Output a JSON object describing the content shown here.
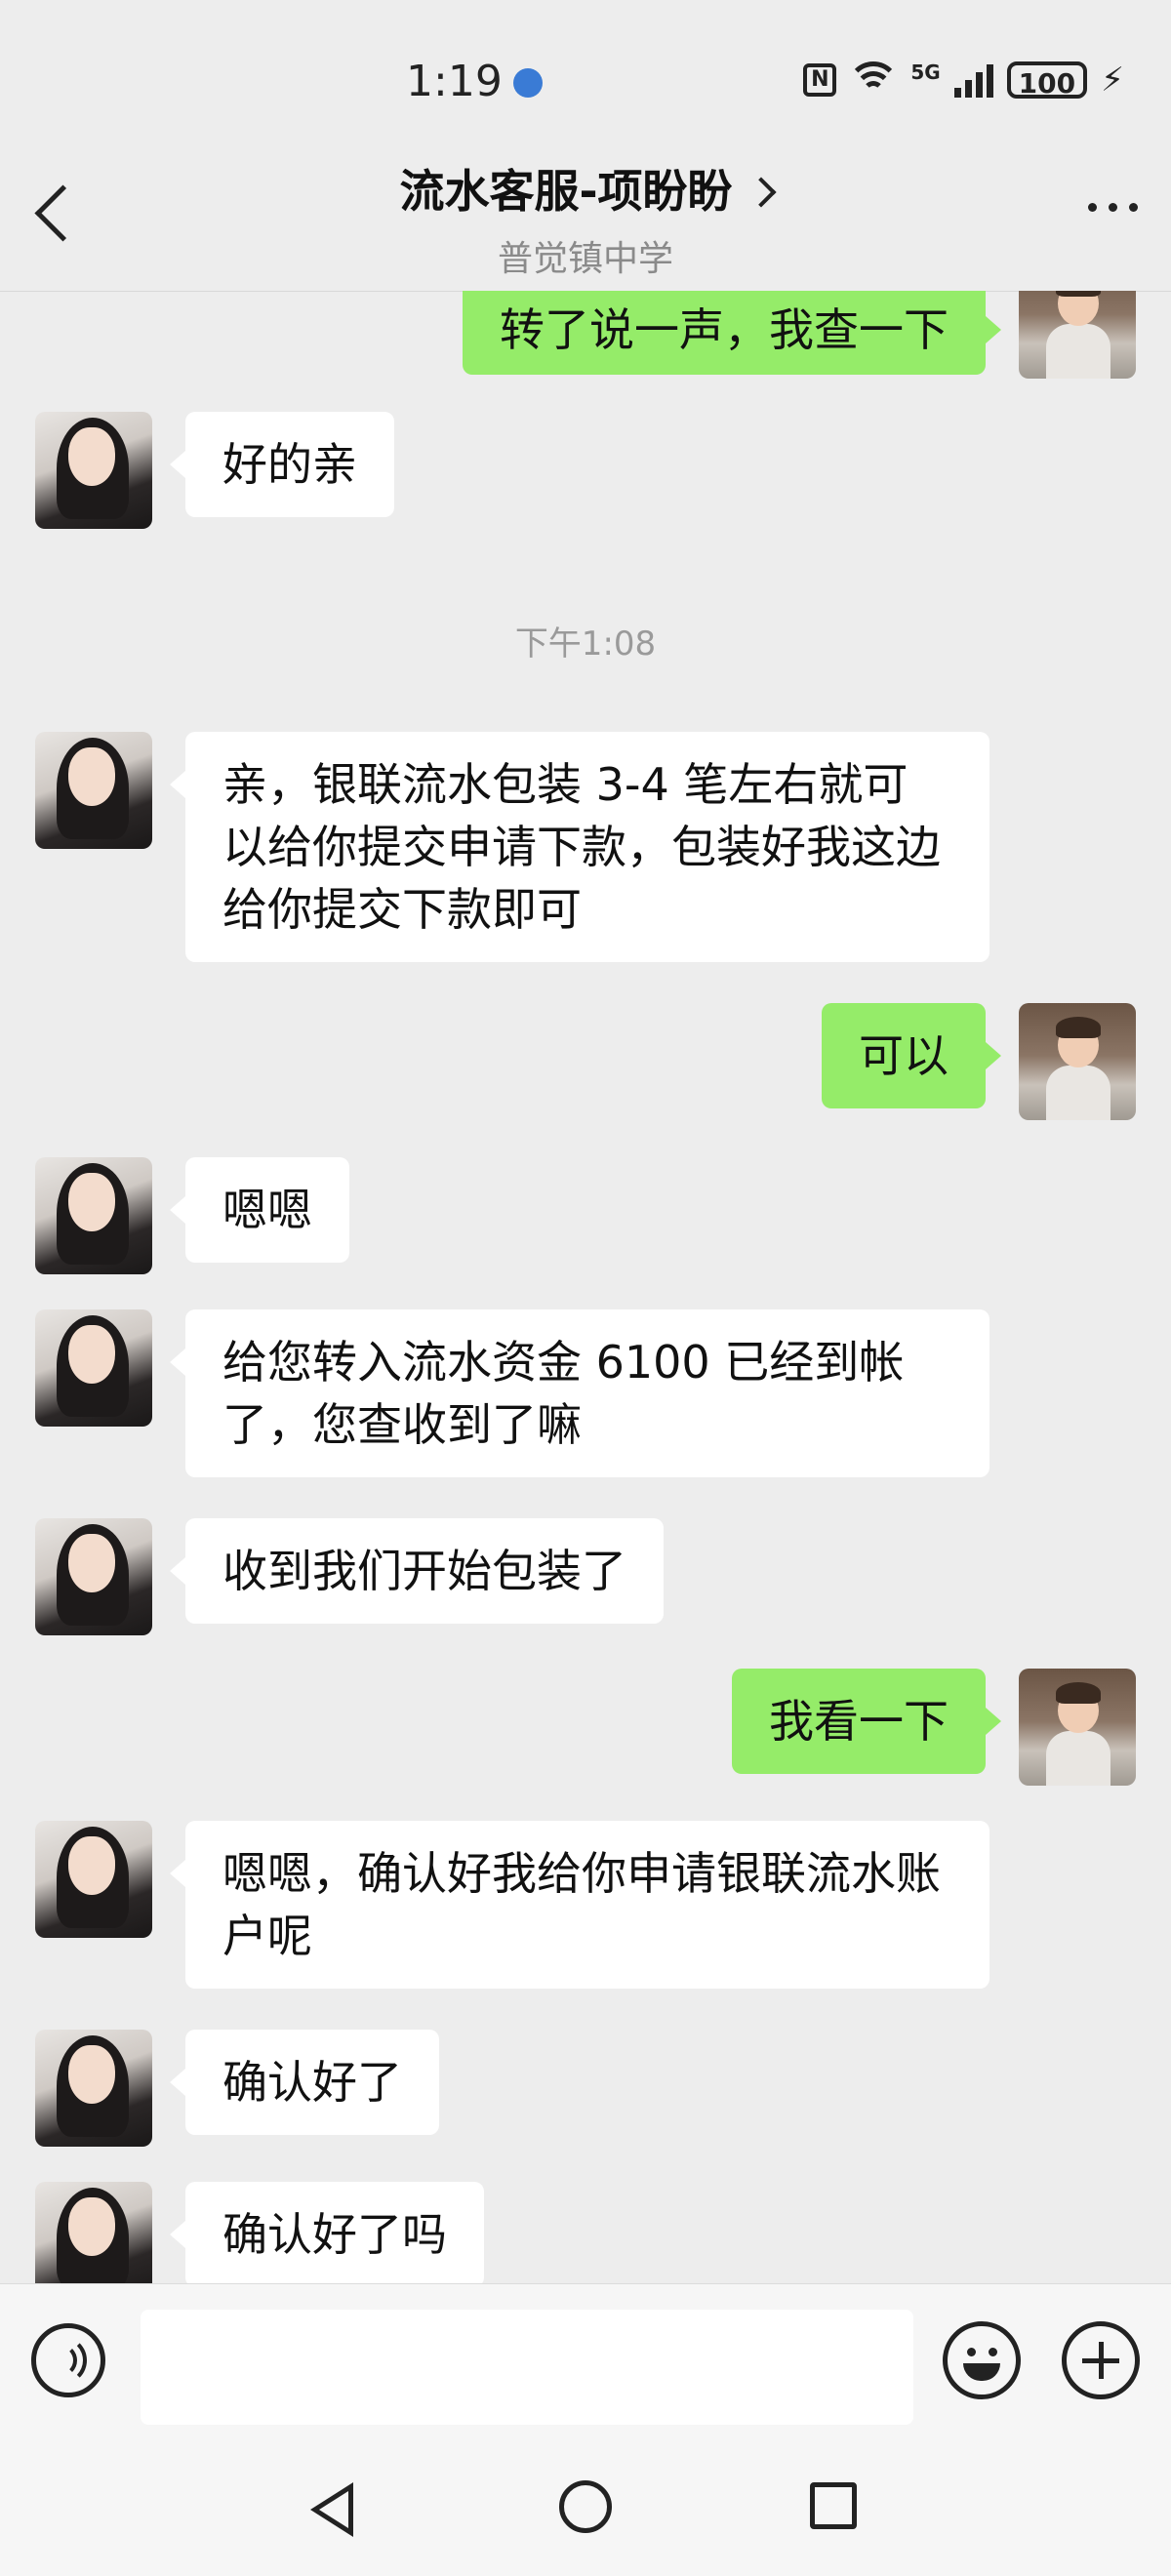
{
  "status_bar": {
    "time": "1:19",
    "nfc_label": "N",
    "network_label": "5G",
    "battery": "100"
  },
  "header": {
    "title": "流水客服-项盼盼",
    "subtitle": "普觉镇中学"
  },
  "messages": [
    {
      "side": "out",
      "text": "转了说一声，我查一下"
    },
    {
      "side": "in",
      "text": "好的亲"
    },
    {
      "type": "timestamp",
      "text": "下午1:08"
    },
    {
      "side": "in",
      "text": "亲，银联流水包装 3-4 笔左右就可以给你提交申请下款，包装好我这边给你提交下款即可"
    },
    {
      "side": "out",
      "text": "可以"
    },
    {
      "side": "in",
      "text": "嗯嗯"
    },
    {
      "side": "in",
      "text": "给您转入流水资金 6100 已经到帐了，您查收到了嘛"
    },
    {
      "side": "in",
      "text": "收到我们开始包装了"
    },
    {
      "side": "out",
      "text": "我看一下"
    },
    {
      "side": "in",
      "text": "嗯嗯，确认好我给你申请银联流水账户呢"
    },
    {
      "side": "in",
      "text": "确认好了"
    },
    {
      "side": "in",
      "text": "确认好了吗"
    }
  ],
  "input": {
    "value": "",
    "placeholder": ""
  },
  "icons": {
    "back": "chevron-left-icon",
    "title_arrow": "chevron-right-icon",
    "more": "more-dots-icon",
    "voice": "voice-icon",
    "emoji": "emoji-icon",
    "plus": "plus-icon"
  },
  "colors": {
    "background": "#ededed",
    "outgoing_bubble": "#95ec69",
    "incoming_bubble": "#ffffff",
    "timestamp_text": "#9a9a9a"
  }
}
